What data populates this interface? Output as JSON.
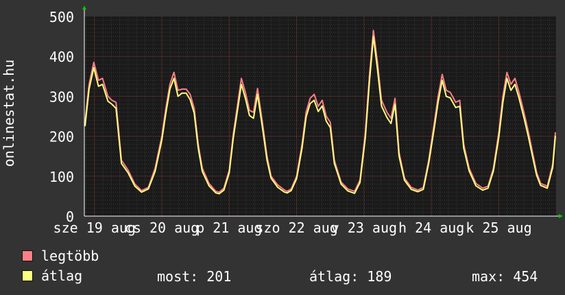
{
  "chart_data": {
    "type": "line",
    "title": "",
    "ylabel": "onlinestat.hu",
    "ylim": [
      0,
      500
    ],
    "yticks": [
      0,
      100,
      200,
      300,
      400,
      500
    ],
    "ytick_labels": [
      "0",
      "100",
      "200",
      "300",
      "400",
      "500"
    ],
    "x_date_labels": [
      {
        "day": 19,
        "text": "sze 19 aug"
      },
      {
        "day": 20,
        "text": "cs 20 aug"
      },
      {
        "day": 21,
        "text": "p 21 aug"
      },
      {
        "day": 22,
        "text": "szo 22 aug"
      },
      {
        "day": 23,
        "text": "v 23 aug"
      },
      {
        "day": 24,
        "text": "h 24 aug"
      },
      {
        "day": 25,
        "text": "k 25 aug"
      }
    ],
    "x_range_days": [
      18.85,
      25.85
    ],
    "grid": true,
    "legend_position": "bottom-left",
    "series": [
      {
        "name": "legtöbb",
        "color": "#ff7f86",
        "points": [
          [
            18.86,
            235
          ],
          [
            18.92,
            330
          ],
          [
            18.99,
            385
          ],
          [
            19.06,
            340
          ],
          [
            19.12,
            345
          ],
          [
            19.2,
            300
          ],
          [
            19.26,
            290
          ],
          [
            19.32,
            285
          ],
          [
            19.4,
            140
          ],
          [
            19.5,
            115
          ],
          [
            19.6,
            80
          ],
          [
            19.7,
            64
          ],
          [
            19.8,
            72
          ],
          [
            19.9,
            120
          ],
          [
            20.0,
            200
          ],
          [
            20.06,
            270
          ],
          [
            20.12,
            330
          ],
          [
            20.18,
            360
          ],
          [
            20.24,
            315
          ],
          [
            20.3,
            318
          ],
          [
            20.36,
            318
          ],
          [
            20.42,
            305
          ],
          [
            20.48,
            270
          ],
          [
            20.54,
            180
          ],
          [
            20.6,
            120
          ],
          [
            20.7,
            82
          ],
          [
            20.8,
            62
          ],
          [
            20.85,
            60
          ],
          [
            20.92,
            70
          ],
          [
            21.0,
            115
          ],
          [
            21.06,
            205
          ],
          [
            21.12,
            275
          ],
          [
            21.18,
            345
          ],
          [
            21.24,
            310
          ],
          [
            21.3,
            265
          ],
          [
            21.36,
            260
          ],
          [
            21.42,
            320
          ],
          [
            21.5,
            225
          ],
          [
            21.56,
            150
          ],
          [
            21.62,
            100
          ],
          [
            21.72,
            78
          ],
          [
            21.82,
            65
          ],
          [
            21.86,
            62
          ],
          [
            21.92,
            68
          ],
          [
            22.0,
            100
          ],
          [
            22.08,
            180
          ],
          [
            22.14,
            260
          ],
          [
            22.2,
            295
          ],
          [
            22.26,
            305
          ],
          [
            22.32,
            275
          ],
          [
            22.38,
            290
          ],
          [
            22.44,
            250
          ],
          [
            22.5,
            235
          ],
          [
            22.56,
            140
          ],
          [
            22.66,
            85
          ],
          [
            22.76,
            68
          ],
          [
            22.86,
            62
          ],
          [
            22.94,
            90
          ],
          [
            23.02,
            210
          ],
          [
            23.08,
            350
          ],
          [
            23.14,
            465
          ],
          [
            23.2,
            385
          ],
          [
            23.26,
            290
          ],
          [
            23.34,
            260
          ],
          [
            23.4,
            245
          ],
          [
            23.46,
            295
          ],
          [
            23.52,
            160
          ],
          [
            23.6,
            95
          ],
          [
            23.7,
            72
          ],
          [
            23.8,
            65
          ],
          [
            23.88,
            72
          ],
          [
            23.96,
            140
          ],
          [
            24.04,
            230
          ],
          [
            24.1,
            300
          ],
          [
            24.16,
            355
          ],
          [
            24.22,
            315
          ],
          [
            24.28,
            310
          ],
          [
            24.36,
            285
          ],
          [
            24.42,
            290
          ],
          [
            24.48,
            180
          ],
          [
            24.56,
            120
          ],
          [
            24.66,
            82
          ],
          [
            24.76,
            70
          ],
          [
            24.84,
            75
          ],
          [
            24.92,
            120
          ],
          [
            25.0,
            210
          ],
          [
            25.06,
            300
          ],
          [
            25.12,
            360
          ],
          [
            25.18,
            330
          ],
          [
            25.24,
            345
          ],
          [
            25.3,
            310
          ],
          [
            25.38,
            255
          ],
          [
            25.44,
            210
          ],
          [
            25.5,
            160
          ],
          [
            25.56,
            110
          ],
          [
            25.62,
            82
          ],
          [
            25.72,
            75
          ],
          [
            25.8,
            130
          ],
          [
            25.84,
            210
          ]
        ]
      },
      {
        "name": "átlag",
        "color": "#ffff80",
        "points": [
          [
            18.86,
            225
          ],
          [
            18.92,
            318
          ],
          [
            18.99,
            372
          ],
          [
            19.06,
            325
          ],
          [
            19.12,
            330
          ],
          [
            19.2,
            288
          ],
          [
            19.26,
            280
          ],
          [
            19.32,
            270
          ],
          [
            19.4,
            132
          ],
          [
            19.5,
            108
          ],
          [
            19.6,
            75
          ],
          [
            19.7,
            60
          ],
          [
            19.8,
            68
          ],
          [
            19.9,
            112
          ],
          [
            20.0,
            190
          ],
          [
            20.06,
            258
          ],
          [
            20.12,
            318
          ],
          [
            20.18,
            345
          ],
          [
            20.24,
            300
          ],
          [
            20.3,
            308
          ],
          [
            20.36,
            308
          ],
          [
            20.42,
            292
          ],
          [
            20.48,
            258
          ],
          [
            20.54,
            170
          ],
          [
            20.6,
            112
          ],
          [
            20.7,
            76
          ],
          [
            20.8,
            58
          ],
          [
            20.85,
            56
          ],
          [
            20.92,
            65
          ],
          [
            21.0,
            108
          ],
          [
            21.06,
            195
          ],
          [
            21.12,
            262
          ],
          [
            21.18,
            330
          ],
          [
            21.24,
            295
          ],
          [
            21.3,
            252
          ],
          [
            21.36,
            245
          ],
          [
            21.42,
            305
          ],
          [
            21.5,
            213
          ],
          [
            21.56,
            140
          ],
          [
            21.62,
            95
          ],
          [
            21.72,
            72
          ],
          [
            21.82,
            60
          ],
          [
            21.86,
            58
          ],
          [
            21.92,
            64
          ],
          [
            22.0,
            94
          ],
          [
            22.08,
            170
          ],
          [
            22.14,
            248
          ],
          [
            22.2,
            282
          ],
          [
            22.26,
            290
          ],
          [
            22.32,
            262
          ],
          [
            22.38,
            276
          ],
          [
            22.44,
            238
          ],
          [
            22.5,
            222
          ],
          [
            22.56,
            132
          ],
          [
            22.66,
            80
          ],
          [
            22.76,
            63
          ],
          [
            22.86,
            57
          ],
          [
            22.94,
            84
          ],
          [
            23.02,
            198
          ],
          [
            23.08,
            335
          ],
          [
            23.14,
            450
          ],
          [
            23.2,
            368
          ],
          [
            23.26,
            276
          ],
          [
            23.34,
            247
          ],
          [
            23.4,
            232
          ],
          [
            23.46,
            280
          ],
          [
            23.52,
            150
          ],
          [
            23.6,
            90
          ],
          [
            23.7,
            67
          ],
          [
            23.8,
            61
          ],
          [
            23.88,
            67
          ],
          [
            23.96,
            132
          ],
          [
            24.04,
            218
          ],
          [
            24.1,
            286
          ],
          [
            24.16,
            340
          ],
          [
            24.22,
            300
          ],
          [
            24.28,
            296
          ],
          [
            24.36,
            272
          ],
          [
            24.42,
            275
          ],
          [
            24.48,
            170
          ],
          [
            24.56,
            113
          ],
          [
            24.66,
            76
          ],
          [
            24.76,
            65
          ],
          [
            24.84,
            70
          ],
          [
            24.92,
            113
          ],
          [
            25.0,
            198
          ],
          [
            25.06,
            285
          ],
          [
            25.12,
            345
          ],
          [
            25.18,
            315
          ],
          [
            25.24,
            330
          ],
          [
            25.3,
            296
          ],
          [
            25.38,
            242
          ],
          [
            25.44,
            198
          ],
          [
            25.5,
            150
          ],
          [
            25.56,
            103
          ],
          [
            25.62,
            77
          ],
          [
            25.72,
            70
          ],
          [
            25.8,
            122
          ],
          [
            25.84,
            201
          ]
        ]
      }
    ]
  },
  "legend": {
    "items": [
      {
        "label": "legtöbb",
        "color": "#ff7f86"
      },
      {
        "label": "átlag",
        "color": "#ffff80"
      }
    ]
  },
  "stats": {
    "now_label": "most:",
    "now_value": "201",
    "avg_label": "átlag:",
    "avg_value": "189",
    "max_label": "max:",
    "max_value": "454"
  }
}
